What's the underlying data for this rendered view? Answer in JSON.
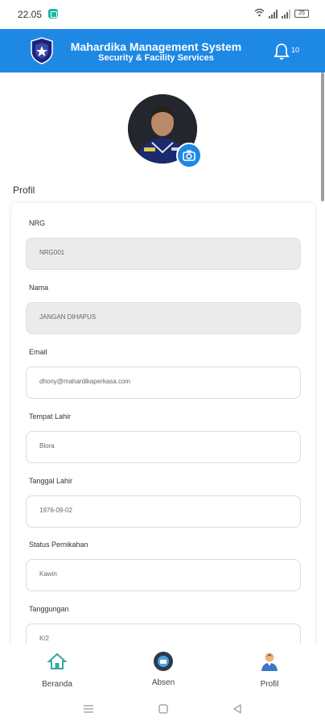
{
  "status_bar": {
    "time": "22.05",
    "battery": "25"
  },
  "header": {
    "title": "Mahardika Management System",
    "subtitle": "Security & Facility Services",
    "notification_count": "10",
    "brand_color": "#1e88e5"
  },
  "profile": {
    "section_title": "Profil"
  },
  "fields": [
    {
      "label": "NRG",
      "value": "NRG001",
      "disabled": true
    },
    {
      "label": "Nama",
      "value": "JANGAN DIHAPUS",
      "disabled": true
    },
    {
      "label": "Email",
      "value": "dhony@mahardikaperkasa.com",
      "disabled": false
    },
    {
      "label": "Tempat Lahir",
      "value": "Blora",
      "disabled": false
    },
    {
      "label": "Tanggal Lahir",
      "value": "1976-09-02",
      "disabled": false
    },
    {
      "label": "Status Pernikahan",
      "value": "Kawin",
      "disabled": false
    },
    {
      "label": "Tanggungan",
      "value": "K/2",
      "disabled": false
    }
  ],
  "bottom_nav": [
    {
      "label": "Beranda",
      "icon": "home-icon"
    },
    {
      "label": "Absen",
      "icon": "absen-icon"
    },
    {
      "label": "Profil",
      "icon": "profile-icon"
    }
  ],
  "icons": {
    "camera": "camera-icon",
    "bell": "bell-icon",
    "system": [
      "recent-apps-icon",
      "home-square-icon",
      "back-triangle-icon"
    ]
  }
}
